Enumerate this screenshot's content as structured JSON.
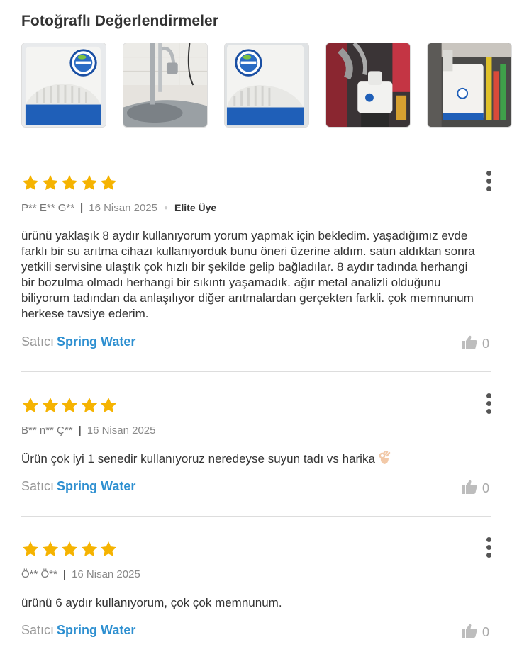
{
  "section_title": "Fotoğraflı Değerlendirmeler",
  "photos": [
    {
      "name": "photo-purifier-front-1"
    },
    {
      "name": "photo-kitchen-faucet"
    },
    {
      "name": "photo-purifier-front-2"
    },
    {
      "name": "photo-under-sink-installation"
    },
    {
      "name": "photo-cabinet-unit"
    }
  ],
  "brand_logo_text": "SPRING WATER",
  "reviews": [
    {
      "rating": 5,
      "author": "P** E** G**",
      "date": "16 Nisan 2025",
      "badge": "Elite Üye",
      "text": "ürünü yaklaşık 8 aydır kullanıyorum yorum yapmak için bekledim. yaşadığımız evde farklı bir su arıtma cihazı kullanıyorduk bunu öneri üzerine aldım.  satın aldıktan sonra yetkili servisine ulaştık çok hızlı bir şekilde gelip bağladılar.  8 aydır tadında herhangi bir bozulma olmadı herhangi bir sıkıntı yaşamadık. ağır metal analizli olduğunu biliyorum tadından da anlaşılıyor diğer arıtmalardan gerçekten farkli. çok memnunum herkese tavsiye ederim.",
      "seller_label": "Satıcı",
      "seller_name": "Spring Water",
      "likes": "0"
    },
    {
      "rating": 5,
      "author": "B** n** Ç**",
      "date": "16 Nisan 2025",
      "badge": "",
      "text": "Ürün çok iyi 1 senedir kullanıyoruz neredeyse suyun tadı vs harika",
      "seller_label": "Satıcı",
      "seller_name": "Spring Water",
      "likes": "0"
    },
    {
      "rating": 5,
      "author": "Ö** Ö**",
      "date": "16 Nisan 2025",
      "badge": "",
      "text": "ürünü 6 aydır kullanıyorum, çok çok memnunum.",
      "seller_label": "Satıcı",
      "seller_name": "Spring Water",
      "likes": "0"
    }
  ],
  "colors": {
    "star": "#f5b301",
    "seller_link": "#2d8fd0",
    "divider": "#dddddd"
  }
}
